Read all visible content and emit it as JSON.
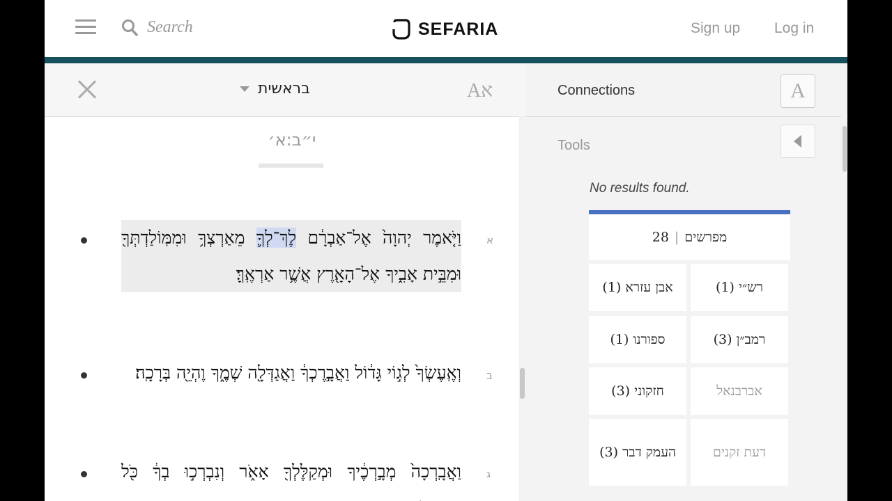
{
  "header": {
    "search_placeholder": "Search",
    "logo_text": "SEFARIA",
    "signup": "Sign up",
    "login": "Log in"
  },
  "text_panel": {
    "book_title": "בראשית",
    "font_toggle": "Aא",
    "section_ref": "י״ב:א׳",
    "verses": [
      {
        "num": "א",
        "text_before": "וַיֹּ֤אמֶר יְהוָה֙ אֶל־אַבְרָ֔ם ",
        "selected": "לֶךְ־לְךָ֛",
        "text_after": " מֵאַרְצְךָ֥ וּמִמּֽוֹלַדְתְּךָ֖ וּמִבֵּ֣ית אָבִ֑יךָ אֶל־הָאָ֖רֶץ אֲשֶׁ֥ר אַרְאֶֽךָּ׃"
      },
      {
        "num": "ב",
        "text": "וְאֶֽעֶשְׂךָ֙ לְג֣וֹי גָּד֔וֹל וַאֲבָ֣רֶכְךָ֔ וַאֲגַדְּלָ֖ה שְׁמֶ֑ךָ וֶהְיֵ֖ה בְּרָכָֽה׃"
      },
      {
        "num": "ג",
        "text": "וַאֲבָֽרְכָה֙ מְבָ֣רְכֶ֔יךָ וּמְקַלֶּלְךָ֖ אָאֹ֑ר וְנִבְרְכ֣וּ בְךָ֔ כֹּ֖ל מִשְׁפְּחֹ֥ת הָאֲדָמָֽה׃"
      }
    ]
  },
  "connections": {
    "title": "Connections",
    "font_button": "A",
    "tools_label": "Tools",
    "no_results": "No results found.",
    "category": {
      "name": "מפרשים",
      "sep": "|",
      "count": "28"
    },
    "commentaries": [
      {
        "label": "רש״י (1)",
        "dim": false
      },
      {
        "label": "אבן עזרא (1)",
        "dim": false
      },
      {
        "label": "רמב״ן (3)",
        "dim": false
      },
      {
        "label": "ספורנו (1)",
        "dim": false
      },
      {
        "label": "אברבנאל",
        "dim": true
      },
      {
        "label": "חזקוני (3)",
        "dim": false
      },
      {
        "label": "דעת זקנים",
        "dim": true
      },
      {
        "label": "העמק דבר (3)",
        "dim": false
      }
    ]
  },
  "colors": {
    "accent_bar": "#18515e",
    "category_bar": "#4871bf",
    "selection": "#cfd9f2"
  }
}
